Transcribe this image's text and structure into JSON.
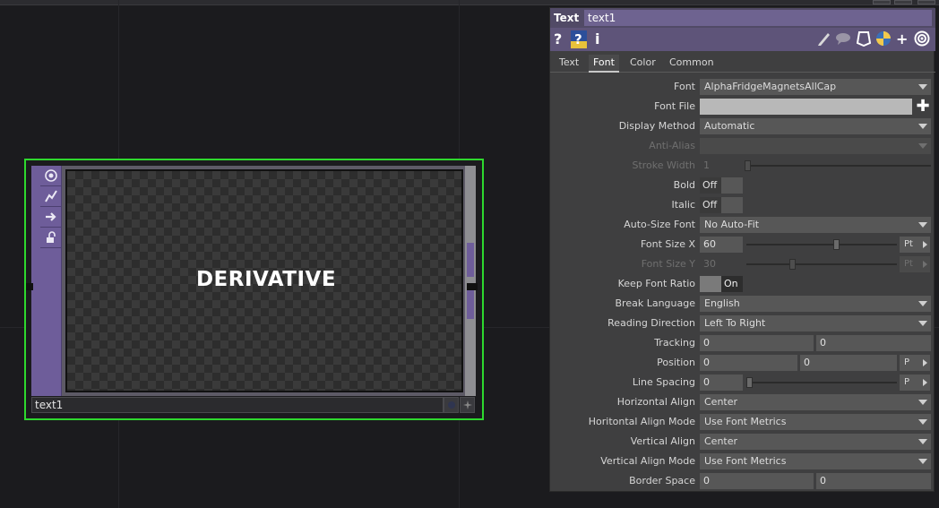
{
  "node": {
    "viewer_text": "DERIVATIVE",
    "name": "text1",
    "icons": [
      "viewer-icon",
      "bypass-icon",
      "export-icon",
      "lock-icon"
    ]
  },
  "panel": {
    "op_type": "Text",
    "op_name": "text1",
    "tabs": [
      "Text",
      "Font",
      "Color",
      "Common"
    ],
    "active_tab": "Font",
    "params": {
      "font": {
        "label": "Font",
        "value": "AlphaFridgeMagnetsAllCap"
      },
      "font_file": {
        "label": "Font File",
        "value": ""
      },
      "display_method": {
        "label": "Display Method",
        "value": "Automatic"
      },
      "anti_alias": {
        "label": "Anti-Alias",
        "value": ""
      },
      "stroke_width": {
        "label": "Stroke Width",
        "value": "1"
      },
      "bold": {
        "label": "Bold",
        "value": "Off"
      },
      "italic": {
        "label": "Italic",
        "value": "Off"
      },
      "auto_size_font": {
        "label": "Auto-Size Font",
        "value": "No Auto-Fit"
      },
      "font_size_x": {
        "label": "Font Size X",
        "value": "60",
        "unit": "Pt"
      },
      "font_size_y": {
        "label": "Font Size Y",
        "value": "30",
        "unit": "Pt"
      },
      "keep_font_ratio": {
        "label": "Keep Font Ratio",
        "value": "On"
      },
      "break_language": {
        "label": "Break Language",
        "value": "English"
      },
      "reading_direction": {
        "label": "Reading Direction",
        "value": "Left To Right"
      },
      "tracking": {
        "label": "Tracking",
        "value1": "0",
        "value2": "0"
      },
      "position": {
        "label": "Position",
        "value1": "0",
        "value2": "0",
        "unit": "P"
      },
      "line_spacing": {
        "label": "Line Spacing",
        "value": "0",
        "unit": "P"
      },
      "horizontal_align": {
        "label": "Horizontal Align",
        "value": "Center"
      },
      "horizontal_align_mode": {
        "label": "Horitontal Align Mode",
        "value": "Use Font Metrics"
      },
      "vertical_align": {
        "label": "Vertical Align",
        "value": "Center"
      },
      "vertical_align_mode": {
        "label": "Vertical Align Mode",
        "value": "Use Font Metrics"
      },
      "border_space": {
        "label": "Border Space",
        "value1": "0",
        "value2": "0"
      }
    }
  },
  "colors": {
    "node_selected_border": "#2ed82e",
    "panel_header": "#514a66",
    "panel_toolbar": "#5e5479",
    "node_accent": "#6e5d9a"
  }
}
